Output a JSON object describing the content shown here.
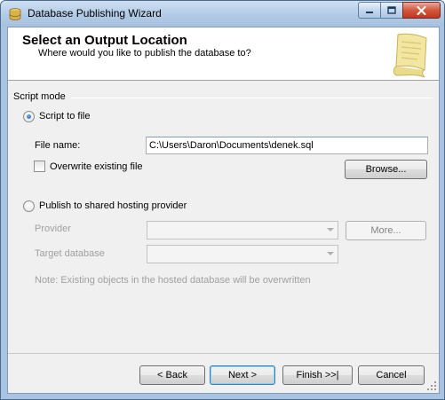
{
  "window": {
    "title": "Database Publishing Wizard"
  },
  "header": {
    "title": "Select an Output Location",
    "subtitle": "Where would you like to publish the database to?",
    "art_icon": "scroll-icon"
  },
  "script_mode": {
    "group_label": "Script mode",
    "script_to_file_label": "Script to file",
    "script_to_file_selected": true,
    "file_name_label": "File name:",
    "file_name_value": "C:\\Users\\Daron\\Documents\\denek.sql",
    "overwrite_label": "Overwrite existing file",
    "overwrite_checked": false,
    "browse_label": "Browse..."
  },
  "hosting": {
    "publish_label": "Publish to shared hosting provider",
    "publish_selected": false,
    "provider_label": "Provider",
    "provider_value": "",
    "more_label": "More...",
    "target_db_label": "Target database",
    "target_db_value": "",
    "note": "Note: Existing objects in the hosted database will be overwritten"
  },
  "footer": {
    "back_label": "< Back",
    "next_label": "Next >",
    "finish_label": "Finish >>|",
    "cancel_label": "Cancel"
  },
  "colors": {
    "accent": "#1a5fb4",
    "close_button": "#c0371d"
  }
}
